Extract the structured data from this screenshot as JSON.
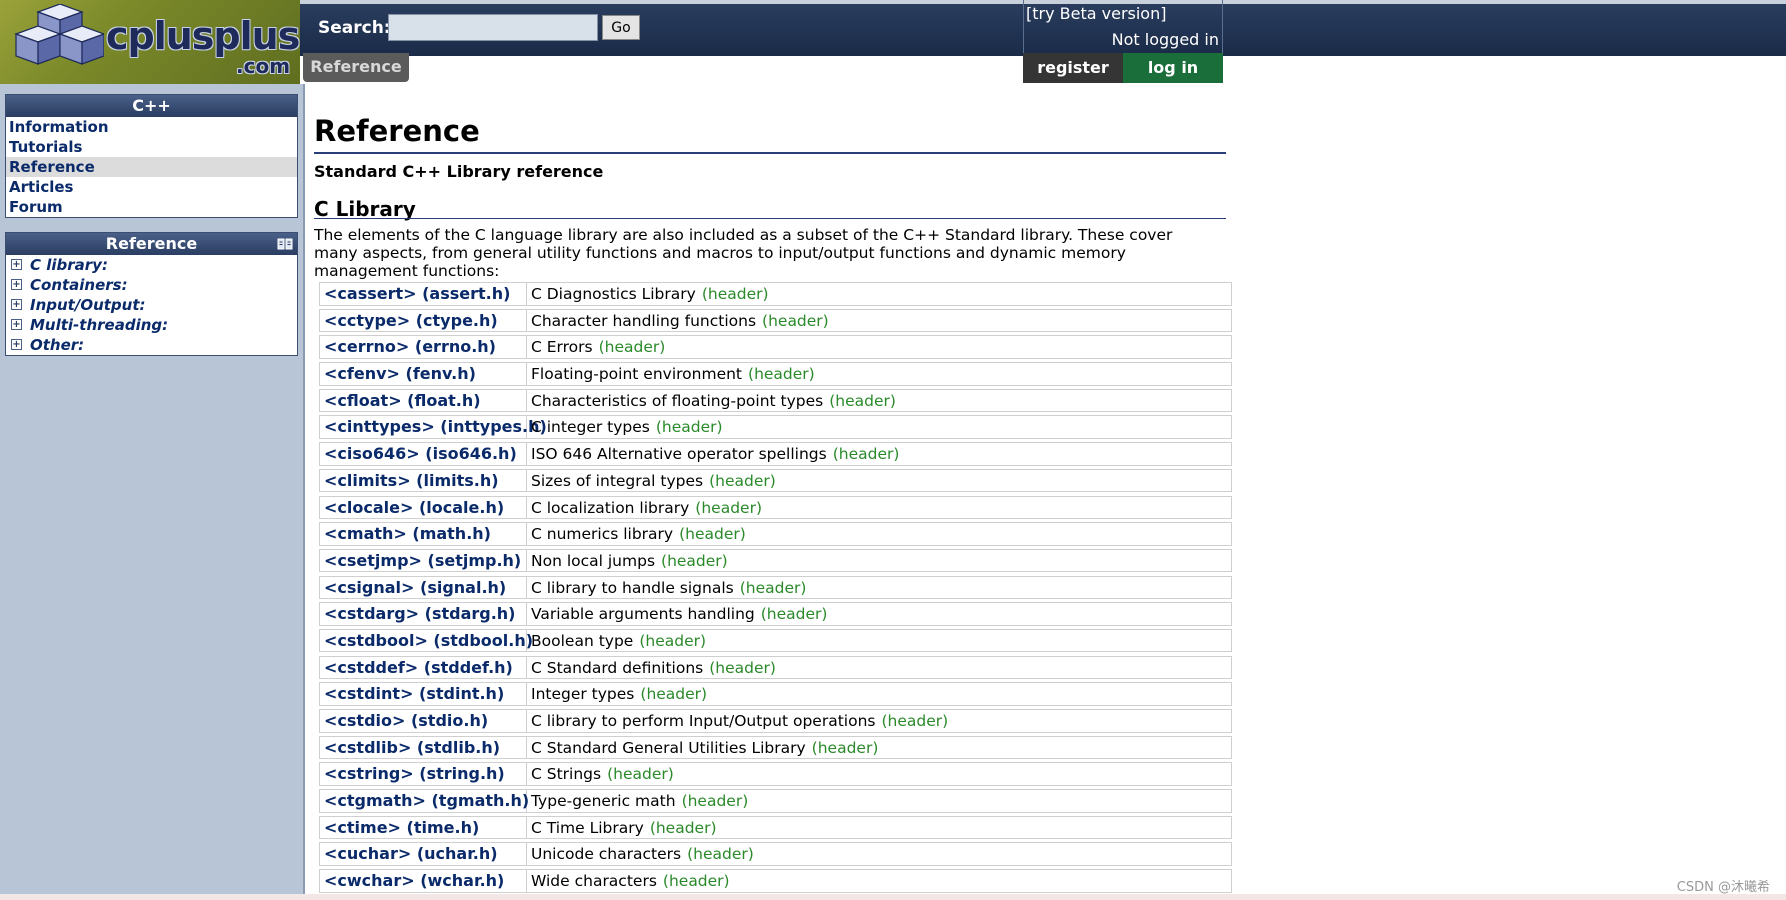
{
  "header": {
    "logo_text": "cplusplus",
    "logo_sub": ".com",
    "search_label": "Search:",
    "search_value": "",
    "go_label": "Go",
    "beta_link": "[try Beta version]",
    "login_status": "Not logged in",
    "tab_reference": "Reference",
    "register_label": "register",
    "login_label": "log in"
  },
  "sidebar": {
    "cpp_title": "C++",
    "cpp_items": [
      {
        "label": "Information"
      },
      {
        "label": "Tutorials"
      },
      {
        "label": "Reference"
      },
      {
        "label": "Articles"
      },
      {
        "label": "Forum"
      }
    ],
    "reference_title": "Reference",
    "reference_items": [
      {
        "label": "C library:"
      },
      {
        "label": "Containers:"
      },
      {
        "label": "Input/Output:"
      },
      {
        "label": "Multi-threading:"
      },
      {
        "label": "Other:"
      }
    ]
  },
  "main": {
    "title": "Reference",
    "subtitle": "Standard C++ Library reference",
    "section_title": "C Library",
    "intro": "The elements of the C language library are also included as a subset of the C++ Standard library. These cover many aspects, from general utility functions and macros to input/output functions and dynamic memory management functions:",
    "header_tag": "(header)",
    "libraries": [
      {
        "name": "<cassert> (assert.h)",
        "desc": "C Diagnostics Library"
      },
      {
        "name": "<cctype> (ctype.h)",
        "desc": "Character handling functions"
      },
      {
        "name": "<cerrno> (errno.h)",
        "desc": "C Errors"
      },
      {
        "name": "<cfenv> (fenv.h)",
        "desc": "Floating-point environment"
      },
      {
        "name": "<cfloat> (float.h)",
        "desc": "Characteristics of floating-point types"
      },
      {
        "name": "<cinttypes> (inttypes.h)",
        "desc": "C integer types"
      },
      {
        "name": "<ciso646> (iso646.h)",
        "desc": "ISO 646 Alternative operator spellings"
      },
      {
        "name": "<climits> (limits.h)",
        "desc": "Sizes of integral types"
      },
      {
        "name": "<clocale> (locale.h)",
        "desc": "C localization library"
      },
      {
        "name": "<cmath> (math.h)",
        "desc": "C numerics library"
      },
      {
        "name": "<csetjmp> (setjmp.h)",
        "desc": "Non local jumps"
      },
      {
        "name": "<csignal> (signal.h)",
        "desc": "C library to handle signals"
      },
      {
        "name": "<cstdarg> (stdarg.h)",
        "desc": "Variable arguments handling"
      },
      {
        "name": "<cstdbool> (stdbool.h)",
        "desc": "Boolean type"
      },
      {
        "name": "<cstddef> (stddef.h)",
        "desc": "C Standard definitions"
      },
      {
        "name": "<cstdint> (stdint.h)",
        "desc": "Integer types"
      },
      {
        "name": "<cstdio> (stdio.h)",
        "desc": "C library to perform Input/Output operations"
      },
      {
        "name": "<cstdlib> (stdlib.h)",
        "desc": "C Standard General Utilities Library"
      },
      {
        "name": "<cstring> (string.h)",
        "desc": "C Strings"
      },
      {
        "name": "<ctgmath> (tgmath.h)",
        "desc": "Type-generic math"
      },
      {
        "name": "<ctime> (time.h)",
        "desc": "C Time Library"
      },
      {
        "name": "<cuchar> (uchar.h)",
        "desc": "Unicode characters"
      },
      {
        "name": "<cwchar> (wchar.h)",
        "desc": "Wide characters"
      }
    ]
  },
  "watermark": "CSDN @沐曦希",
  "colors": {
    "header_bg": "#1a2b48",
    "link": "#0a2a6a",
    "header_tag": "#2a8a2a",
    "login_button": "#1a6e3a",
    "register_button": "#353535",
    "sidebar_bg": "#b8c5d6"
  }
}
